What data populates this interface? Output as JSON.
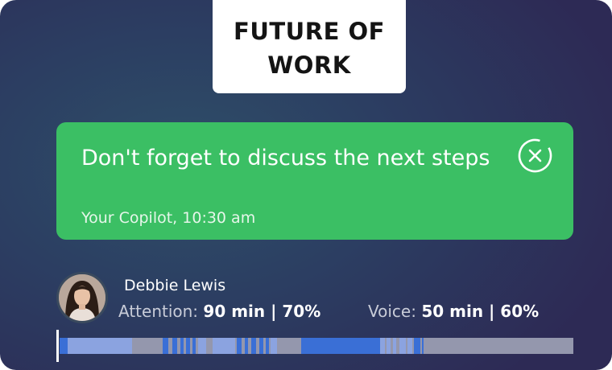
{
  "title": "FUTURE OF\nWORK",
  "notification": {
    "message": "Don't forget to discuss the next steps",
    "sender_time": "Your Copilot, 10:30 am",
    "close_icon": "close-circle-icon"
  },
  "participant": {
    "name": "Debbie Lewis",
    "attention_label": "Attention: ",
    "attention_value": "90 min | 70%",
    "voice_label": "Voice: ",
    "voice_value": "50 min | 60%"
  },
  "colors": {
    "accent_green": "#3bbf64",
    "timeline_base": "#9497ad",
    "timeline_light": "#8ba3e0",
    "timeline_dark": "#3a6fd6"
  }
}
